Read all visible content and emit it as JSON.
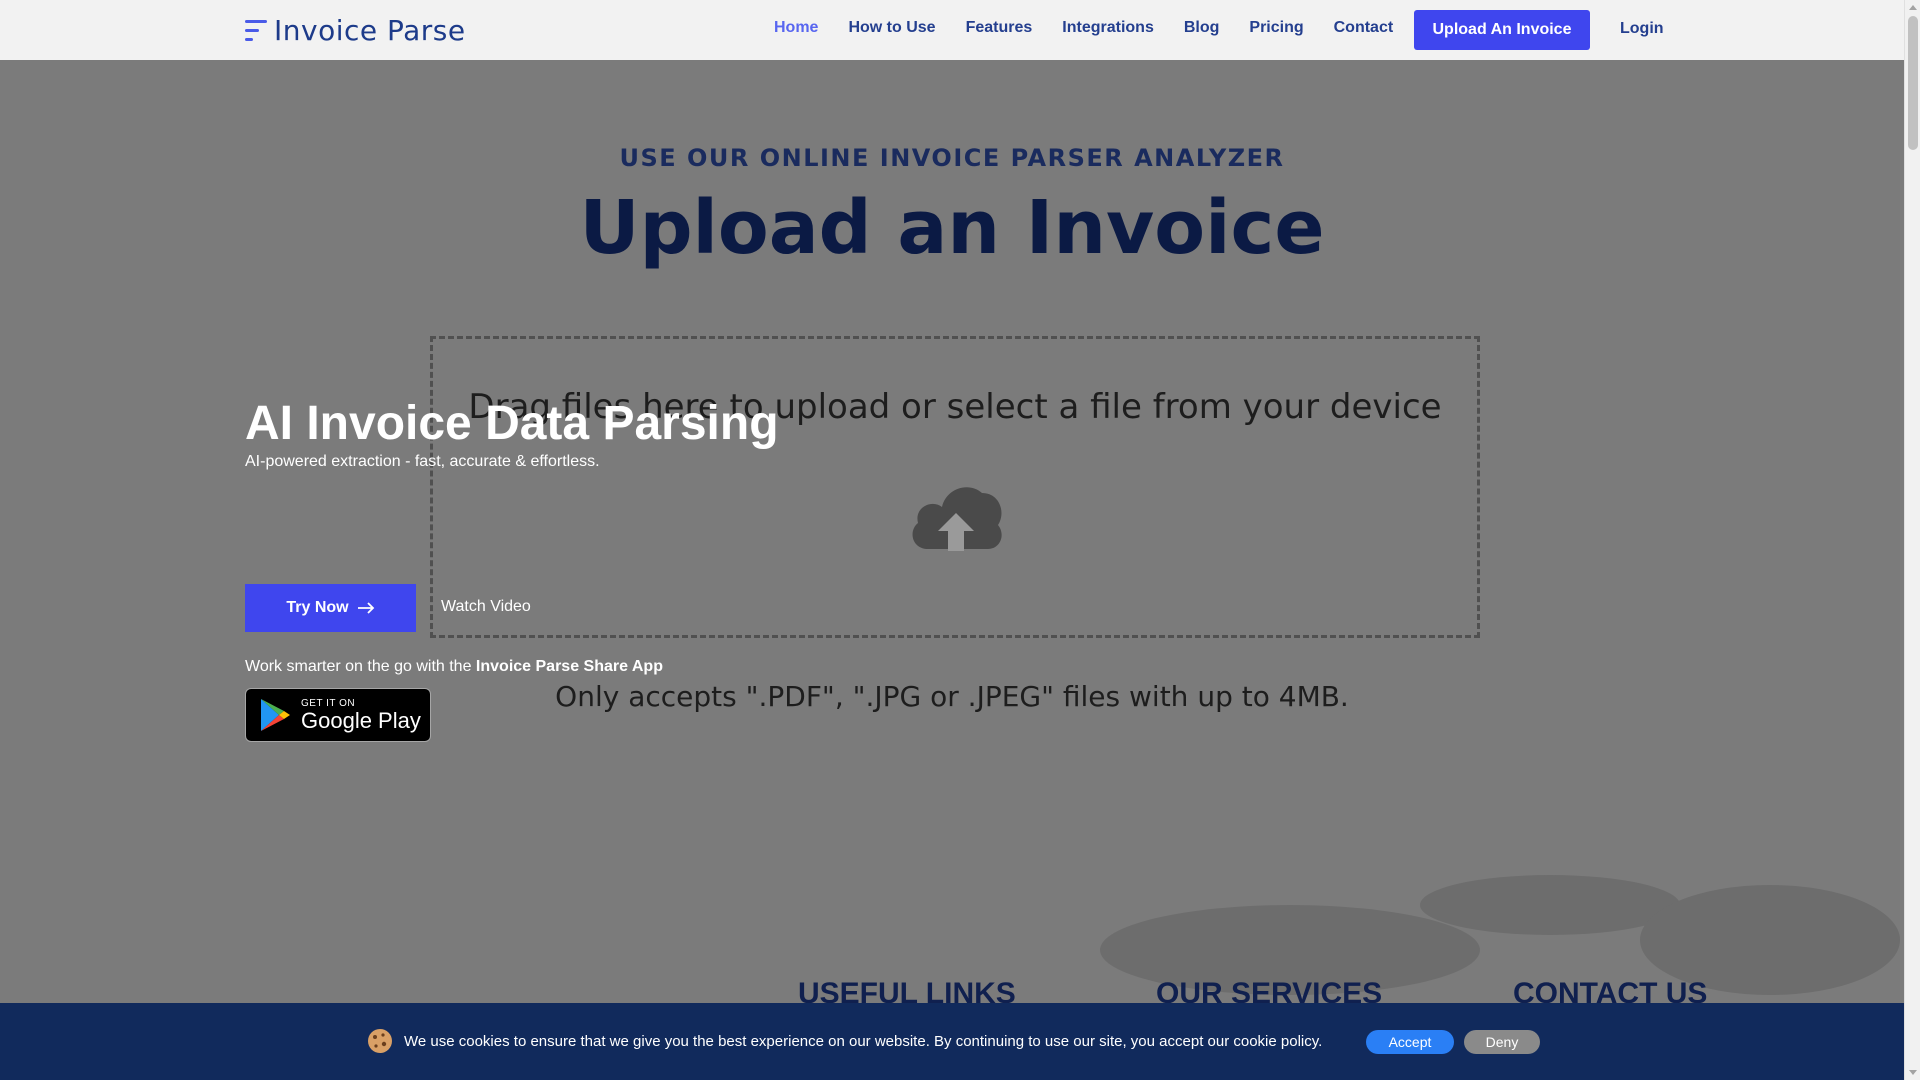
{
  "brand": {
    "name": "Invoice Parse",
    "accent": "#3f46ee",
    "nav_color": "#243f8f"
  },
  "nav": {
    "items": [
      {
        "label": "Home",
        "active": true
      },
      {
        "label": "How to Use"
      },
      {
        "label": "Features"
      },
      {
        "label": "Integrations"
      },
      {
        "label": "Blog"
      },
      {
        "label": "Pricing"
      },
      {
        "label": "Contact"
      }
    ],
    "cta": "Upload An Invoice",
    "login": "Login"
  },
  "hero_bg": {
    "eyebrow": "USE OUR ONLINE INVOICE PARSER ANALYZER",
    "title": "Upload an Invoice",
    "dropzone_text": "Drag files here to upload or select a file from your device",
    "accepts": "Only accepts \".PDF\", \".JPG or .JPEG\" files with up to 4MB."
  },
  "hero": {
    "title": "AI Invoice Data Parsing",
    "subtitle": "AI-powered extraction - fast, accurate & effortless.",
    "try_now": "Try Now",
    "watch_video": "Watch Video",
    "app_line_prefix": "Work smarter on the go with the ",
    "app_line_bold": "Invoice Parse Share App",
    "play_small": "GET IT ON",
    "play_big": "Google Play"
  },
  "footer": {
    "useful_links": "USEFUL LINKS",
    "our_services": "OUR SERVICES",
    "contact_us": "CONTACT US"
  },
  "cookie": {
    "text": "We use cookies to ensure that we give you the best experience on our website. By continuing to use our site, you accept our cookie policy.",
    "accept": "Accept",
    "deny": "Deny"
  }
}
